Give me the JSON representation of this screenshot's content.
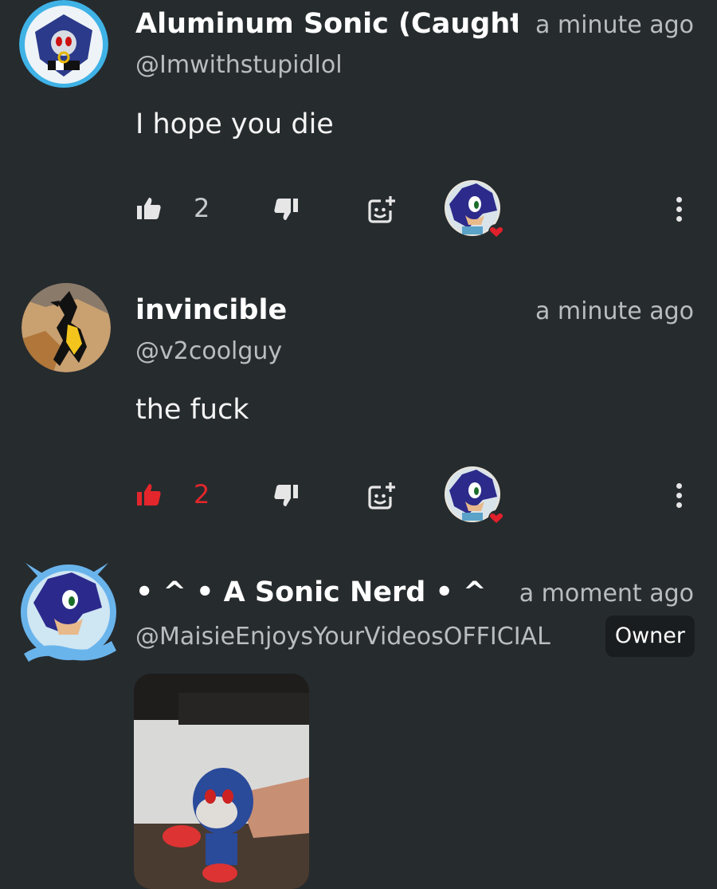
{
  "comments": [
    {
      "name": "Aluminum Sonic (Caught",
      "time": "a minute ago",
      "handle": "@Imwithstupidlol",
      "text": "I hope you die",
      "likes": "2",
      "liked": false
    },
    {
      "name": "invincible",
      "time": "a minute ago",
      "handle": "@v2coolguy",
      "text": "the fuck",
      "likes": "2",
      "liked": true
    },
    {
      "name": "• ^ • A Sonic Nerd • ^ •",
      "time": "a moment ago",
      "handle": "@MaisieEnjoysYourVideosOFFICIAL",
      "badge": "Owner"
    }
  ],
  "colors": {
    "background": "#262b2e",
    "liked": "#e3262b",
    "secondary_text": "#b9bdbf",
    "heart": "#e0202a"
  },
  "icons": [
    "like-icon",
    "dislike-icon",
    "reply-icon",
    "creator-heart-icon",
    "more-options-icon"
  ]
}
